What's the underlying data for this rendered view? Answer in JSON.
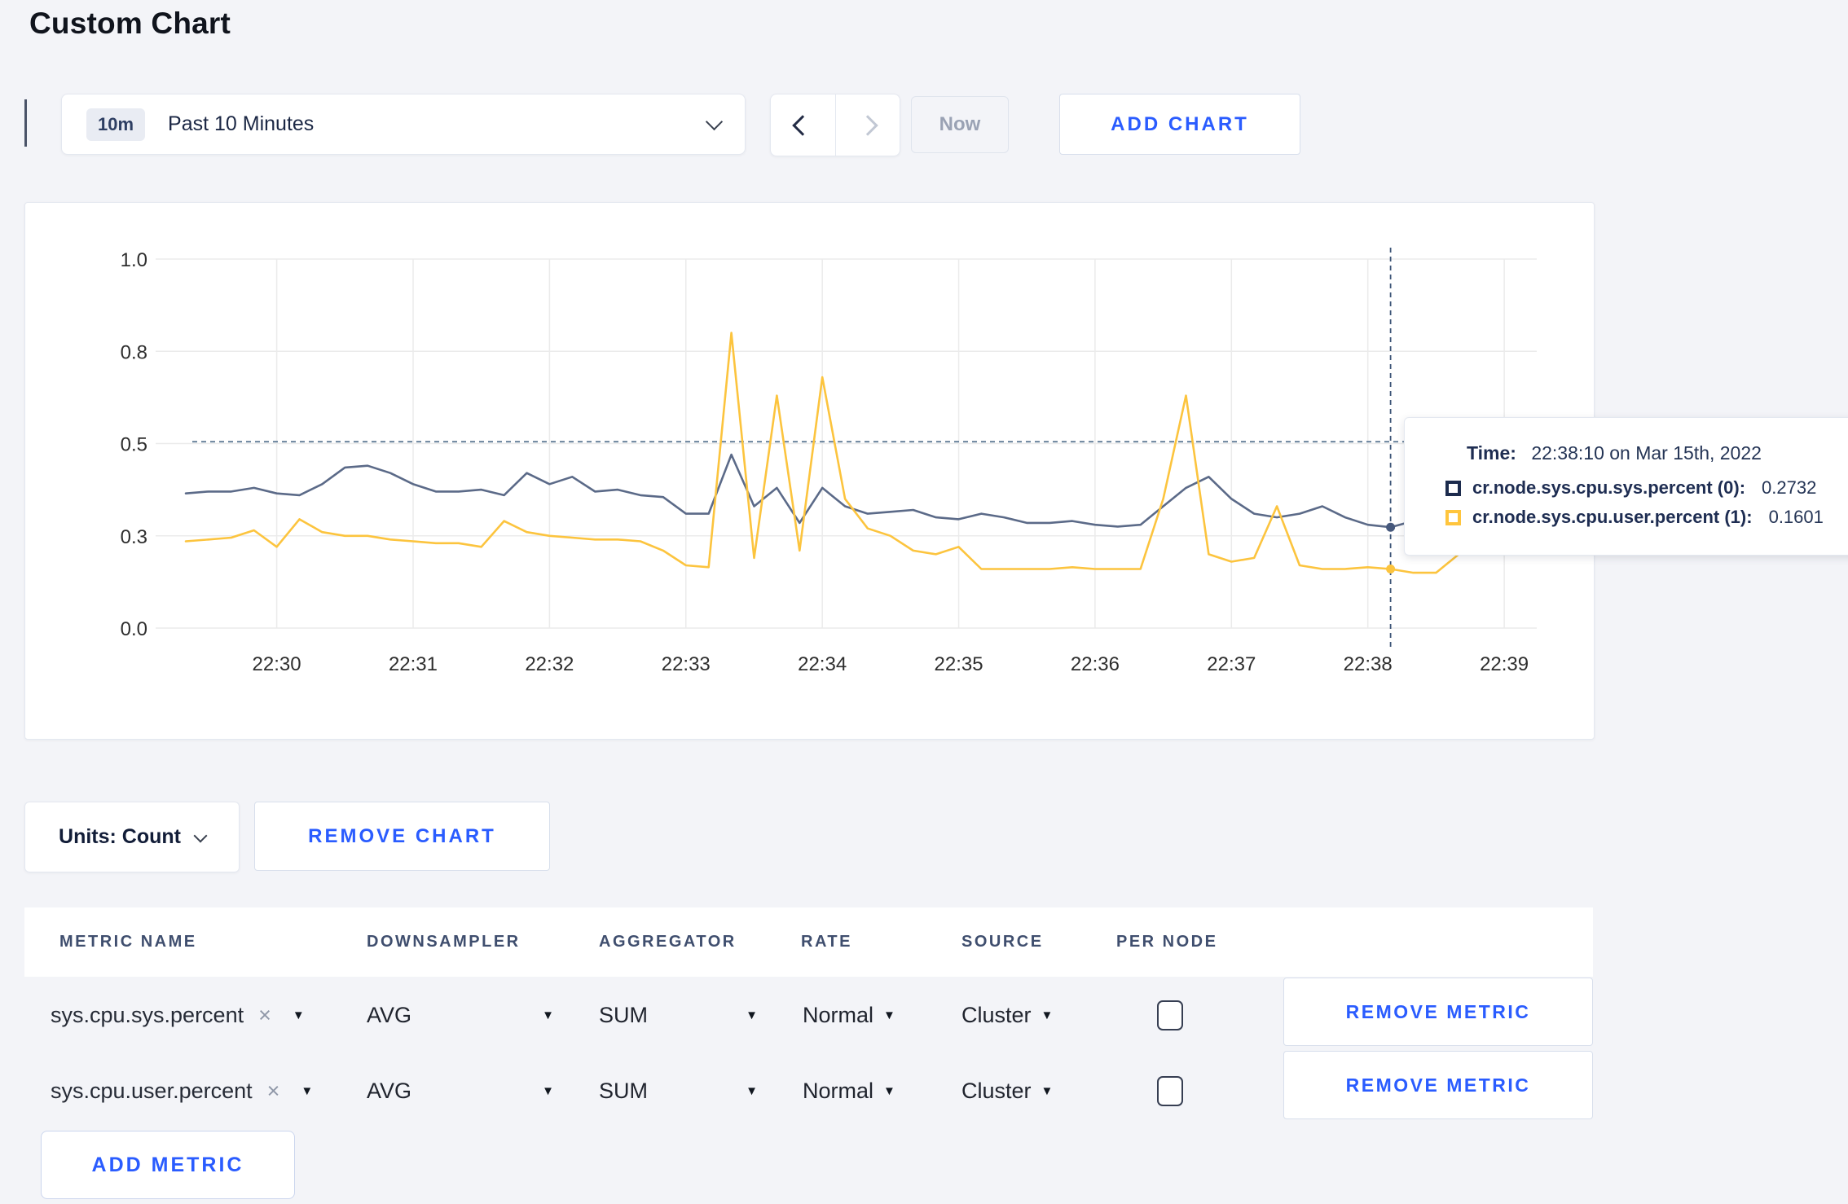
{
  "page": {
    "title": "Custom Chart"
  },
  "icons": {
    "close": "×",
    "caret_down": "▼"
  },
  "toolbar": {
    "time_badge": "10m",
    "time_label": "Past 10 Minutes",
    "now_label": "Now",
    "add_chart_label": "ADD CHART"
  },
  "chart_data": {
    "type": "line",
    "grid": true,
    "ylim": [
      0,
      1
    ],
    "y_tick_values": [
      1.0,
      0.75,
      0.5,
      0.25,
      0.0
    ],
    "y_tick_labels": [
      "1.0",
      "0.8",
      "0.5",
      "0.3",
      "0.0"
    ],
    "x_tick_labels": [
      "22:30",
      "22:31",
      "22:32",
      "22:33",
      "22:34",
      "22:35",
      "22:36",
      "22:37",
      "22:38",
      "22:39"
    ],
    "x_start": "22:29:20",
    "x_step_seconds": 10,
    "x_tick_first_index": 4,
    "x_tick_step": 6,
    "grid_color": "#ebebeb",
    "tick_color": "#2e2e2e",
    "series": [
      {
        "name": "cr.node.sys.cpu.sys.percent (0)",
        "color": "#5b6a88",
        "values": [
          0.365,
          0.37,
          0.37,
          0.38,
          0.365,
          0.36,
          0.39,
          0.435,
          0.44,
          0.42,
          0.39,
          0.37,
          0.37,
          0.375,
          0.36,
          0.42,
          0.39,
          0.41,
          0.37,
          0.375,
          0.36,
          0.355,
          0.31,
          0.31,
          0.47,
          0.33,
          0.38,
          0.285,
          0.38,
          0.33,
          0.31,
          0.315,
          0.32,
          0.3,
          0.295,
          0.31,
          0.3,
          0.285,
          0.285,
          0.29,
          0.28,
          0.275,
          0.28,
          0.33,
          0.38,
          0.41,
          0.35,
          0.31,
          0.3,
          0.31,
          0.33,
          0.3,
          0.28,
          0.2732,
          0.29,
          0.3,
          0.31,
          0.3,
          0.3,
          0.31
        ]
      },
      {
        "name": "cr.node.sys.cpu.user.percent (1)",
        "color": "#fcc43e",
        "values": [
          0.235,
          0.24,
          0.245,
          0.265,
          0.22,
          0.295,
          0.26,
          0.25,
          0.25,
          0.24,
          0.235,
          0.23,
          0.23,
          0.22,
          0.29,
          0.26,
          0.25,
          0.245,
          0.24,
          0.24,
          0.235,
          0.21,
          0.17,
          0.165,
          0.8,
          0.19,
          0.63,
          0.21,
          0.68,
          0.35,
          0.27,
          0.25,
          0.21,
          0.2,
          0.22,
          0.16,
          0.16,
          0.16,
          0.16,
          0.165,
          0.16,
          0.16,
          0.16,
          0.35,
          0.63,
          0.2,
          0.18,
          0.19,
          0.33,
          0.17,
          0.16,
          0.16,
          0.165,
          0.1601,
          0.15,
          0.15,
          0.2,
          0.27,
          0.21,
          0.27
        ]
      }
    ],
    "crosshair": {
      "vline_index": 53,
      "hline_value": 0.505,
      "hline_color": "#54718e",
      "vline_color": "#3d5577",
      "points": [
        {
          "value": 0.2732,
          "color": "#46587c"
        },
        {
          "value": 0.1601,
          "color": "#fcc43e"
        }
      ]
    }
  },
  "tooltip": {
    "time_label": "Time:",
    "time_value": "22:38:10 on Mar 15th, 2022",
    "rows": [
      {
        "label": "cr.node.sys.cpu.sys.percent (0):",
        "value": "0.2732",
        "swatch_color": "#1c2b4d"
      },
      {
        "label": "cr.node.sys.cpu.user.percent (1):",
        "value": "0.1601",
        "swatch_color": "#ffc53d"
      }
    ]
  },
  "chart_controls": {
    "units_label": "Units: Count",
    "remove_chart_label": "REMOVE CHART"
  },
  "metrics_table": {
    "headers": [
      "METRIC NAME",
      "DOWNSAMPLER",
      "AGGREGATOR",
      "RATE",
      "SOURCE",
      "PER NODE"
    ],
    "rows": [
      {
        "metric": "sys.cpu.sys.percent",
        "downsampler": "AVG",
        "aggregator": "SUM",
        "rate": "Normal",
        "source": "Cluster",
        "per_node": false,
        "remove_label": "REMOVE METRIC"
      },
      {
        "metric": "sys.cpu.user.percent",
        "downsampler": "AVG",
        "aggregator": "SUM",
        "rate": "Normal",
        "source": "Cluster",
        "per_node": false,
        "remove_label": "REMOVE METRIC"
      }
    ],
    "add_metric_label": "ADD METRIC"
  }
}
